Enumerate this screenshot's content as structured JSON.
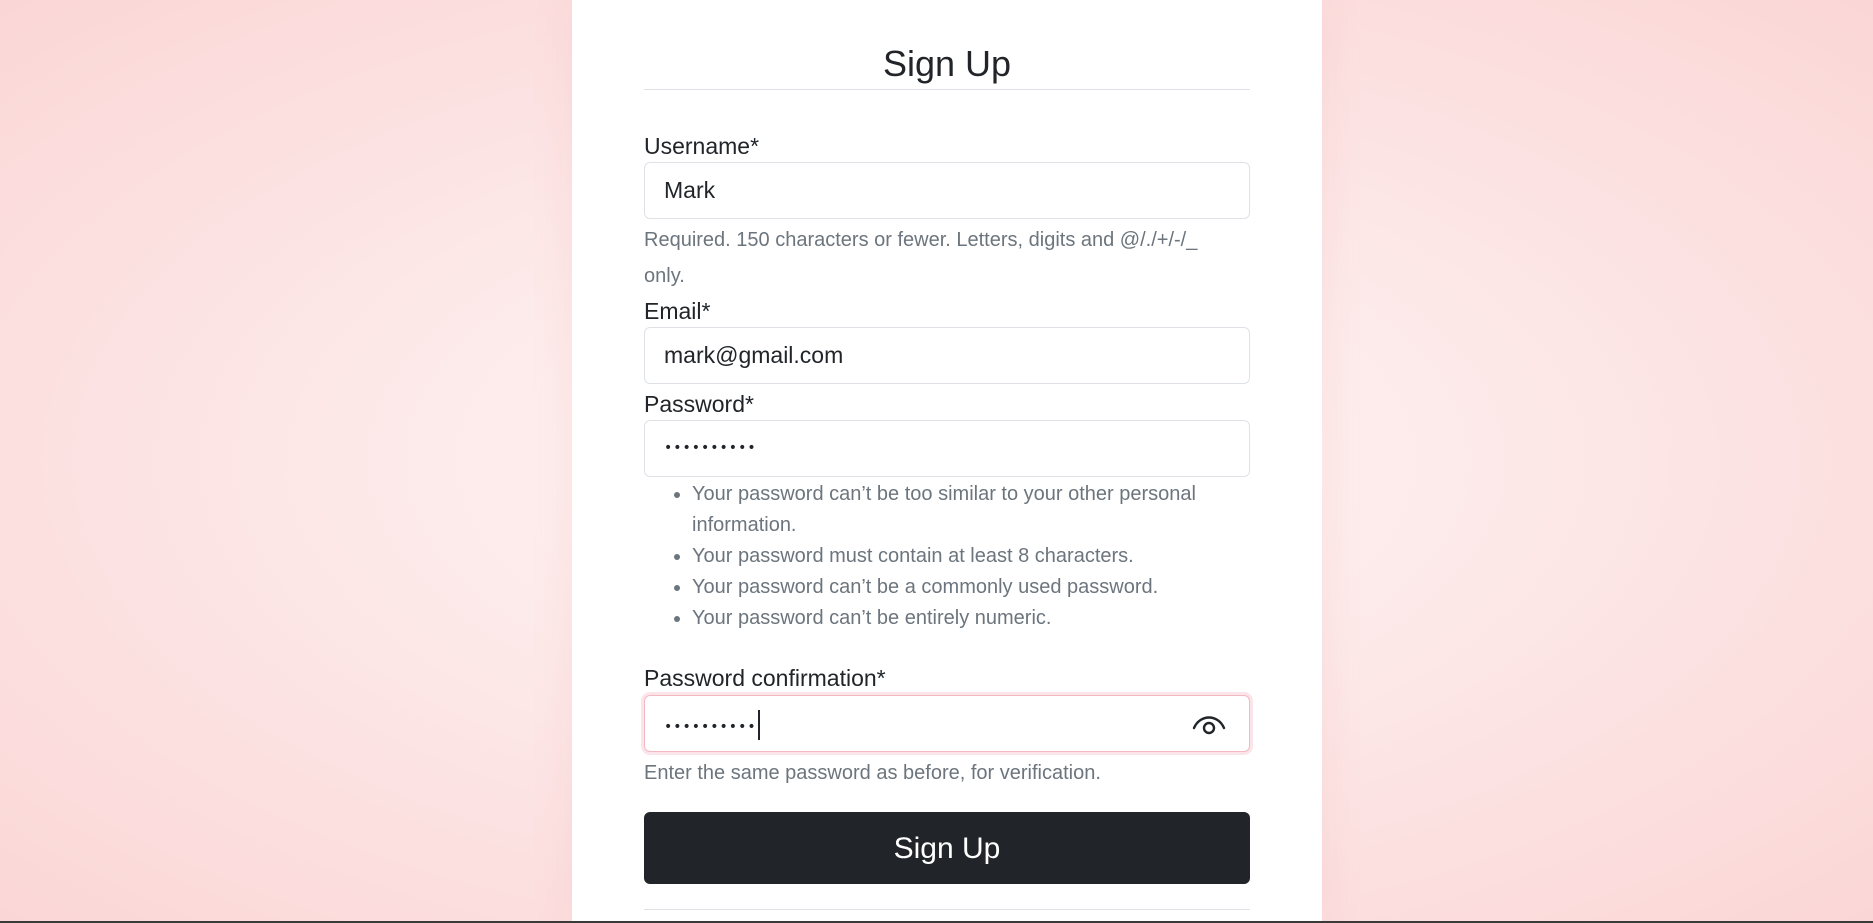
{
  "form": {
    "title": "Sign Up",
    "username": {
      "label": "Username*",
      "value": "Mark",
      "help_line1": "Required. 150 characters or fewer. Letters, digits and @/./+/-/_",
      "help_line2": "only."
    },
    "email": {
      "label": "Email*",
      "value": "mark@gmail.com"
    },
    "password": {
      "label": "Password*",
      "value_masked": "••••••••••",
      "rules": [
        "Your password can’t be too similar to your other personal information.",
        "Your password must contain at least 8 characters.",
        "Your password can’t be a commonly used password.",
        "Your password can’t be entirely numeric."
      ]
    },
    "password_confirmation": {
      "label": "Password confirmation*",
      "value_masked": "••••••••••",
      "help": "Enter the same password as before, for verification.",
      "toggle_icon": "eye-icon"
    },
    "submit_label": "Sign Up"
  },
  "colors": {
    "button_bg": "#212529",
    "focus_border": "#f4b8c2",
    "help_text": "#6c757d",
    "page_bg": "#fbd6d6"
  }
}
